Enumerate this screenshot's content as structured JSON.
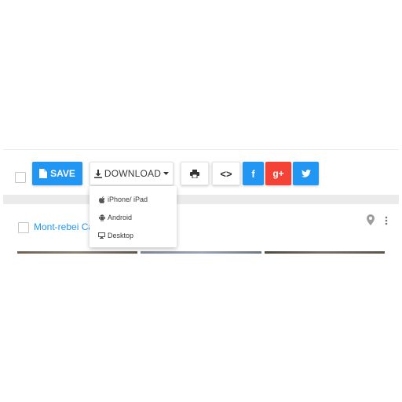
{
  "toolbar": {
    "save_label": "SAVE",
    "download_label": "DOWNLOAD",
    "embed_label": "<>",
    "facebook_label": "f",
    "google_plus_label": "g+"
  },
  "download_menu": {
    "items": [
      {
        "label": "iPhone/ iPad",
        "icon": "apple-icon"
      },
      {
        "label": "Android",
        "icon": "android-icon"
      },
      {
        "label": "Desktop",
        "icon": "desktop-icon"
      }
    ]
  },
  "card": {
    "title": "Mont-rebei Ca"
  },
  "colors": {
    "primary_blue": "#2196f3",
    "google_red": "#f44336",
    "text_dark": "#3a3a3a",
    "band_gray": "#ebebeb"
  }
}
